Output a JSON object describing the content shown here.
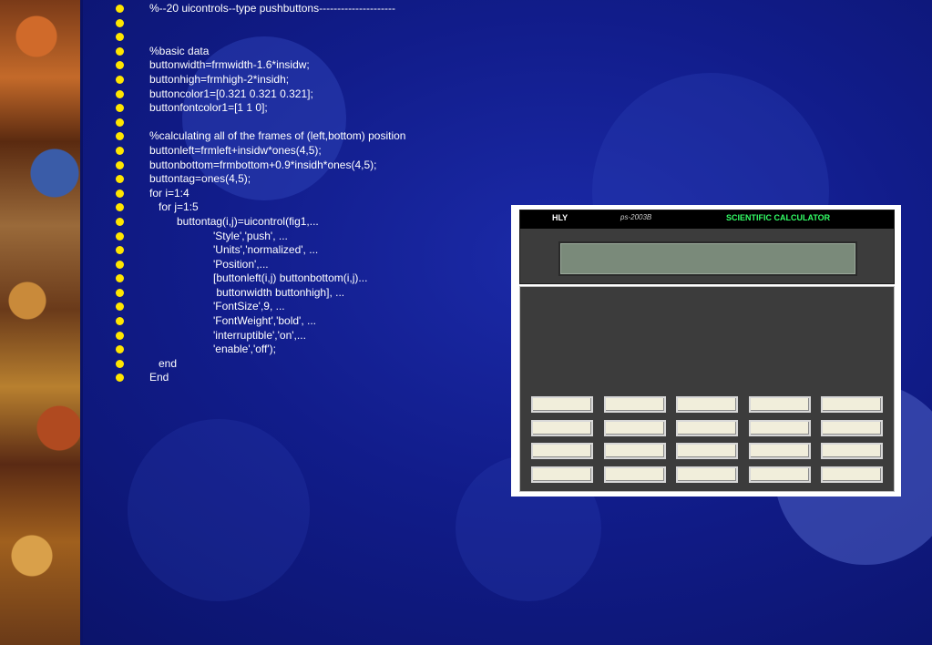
{
  "code_lines": [
    "%--20 uicontrols--type pushbuttons---------------------",
    "",
    "",
    "%basic data",
    "buttonwidth=frmwidth-1.6*insidw;",
    "buttonhigh=frmhigh-2*insidh;",
    "buttoncolor1=[0.321 0.321 0.321];",
    "buttonfontcolor1=[1 1 0];",
    "",
    "%calculating all of the frames of (left,bottom) position",
    "buttonleft=frmleft+insidw*ones(4,5);",
    "buttonbottom=frmbottom+0.9*insidh*ones(4,5);",
    "buttontag=ones(4,5);",
    "for i=1:4",
    "   for j=1:5",
    "         buttontag(i,j)=uicontrol(fig1,...",
    "                     'Style','push', ...",
    "                     'Units','normalized', ...",
    "                     'Position',...",
    "                     [buttonleft(i,j) buttonbottom(i,j)...",
    "                      buttonwidth buttonhigh], ...",
    "                     'FontSize',9, ...",
    "                     'FontWeight','bold', ...",
    "                     'interruptible','on',...",
    "                     'enable','off');",
    "   end",
    "End"
  ],
  "calculator": {
    "brand": "HLY",
    "model": "ps-2003B",
    "title": "SCIENTIFIC CALCULATOR",
    "rows": 4,
    "cols": 5
  },
  "colors": {
    "bullet": "#ffe600",
    "title_green": "#33ff66",
    "panel_gray": "#3c3c3c",
    "key_face": "#f1eedb"
  }
}
